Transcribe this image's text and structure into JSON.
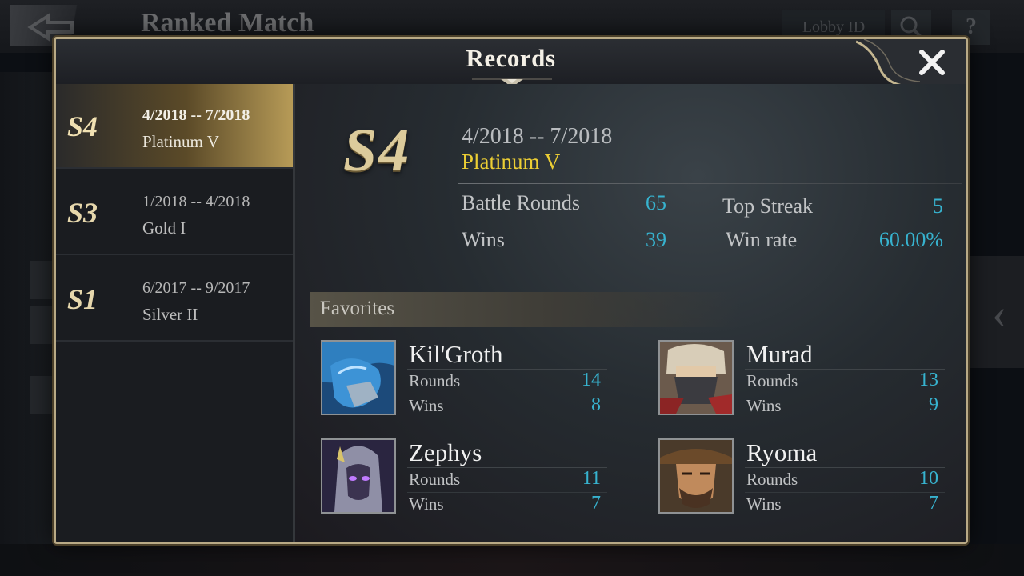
{
  "background": {
    "title": "Ranked Match",
    "lobby_label": "Lobby ID",
    "help_glyph": "?"
  },
  "modal": {
    "title": "Records",
    "close_icon": "close-icon"
  },
  "seasons": [
    {
      "code": "S4",
      "dates": "4/2018 -- 7/2018",
      "rank": "Platinum V",
      "active": true
    },
    {
      "code": "S3",
      "dates": "1/2018 -- 4/2018",
      "rank": "Gold I",
      "active": false
    },
    {
      "code": "S1",
      "dates": "6/2017 -- 9/2017",
      "rank": "Silver II",
      "active": false
    }
  ],
  "detail": {
    "code": "S4",
    "dates": "4/2018 -- 7/2018",
    "rank": "Platinum V",
    "stats": {
      "battle_rounds_label": "Battle Rounds",
      "battle_rounds": "65",
      "wins_label": "Wins",
      "wins": "39",
      "top_streak_label": "Top Streak",
      "top_streak": "5",
      "win_rate_label": "Win rate",
      "win_rate": "60.00%"
    }
  },
  "favorites": {
    "title": "Favorites",
    "heroes": [
      {
        "name": "Kil'Groth",
        "rounds_label": "Rounds",
        "rounds": "14",
        "wins_label": "Wins",
        "wins": "8"
      },
      {
        "name": "Murad",
        "rounds_label": "Rounds",
        "rounds": "13",
        "wins_label": "Wins",
        "wins": "9"
      },
      {
        "name": "Zephys",
        "rounds_label": "Rounds",
        "rounds": "11",
        "wins_label": "Wins",
        "wins": "7"
      },
      {
        "name": "Ryoma",
        "rounds_label": "Rounds",
        "rounds": "10",
        "wins_label": "Wins",
        "wins": "7"
      }
    ]
  },
  "colors": {
    "accent_gold": "#dccb9b",
    "rank_yellow": "#ecce34",
    "value_cyan": "#37b3cf",
    "frame": "#b9aa86"
  }
}
